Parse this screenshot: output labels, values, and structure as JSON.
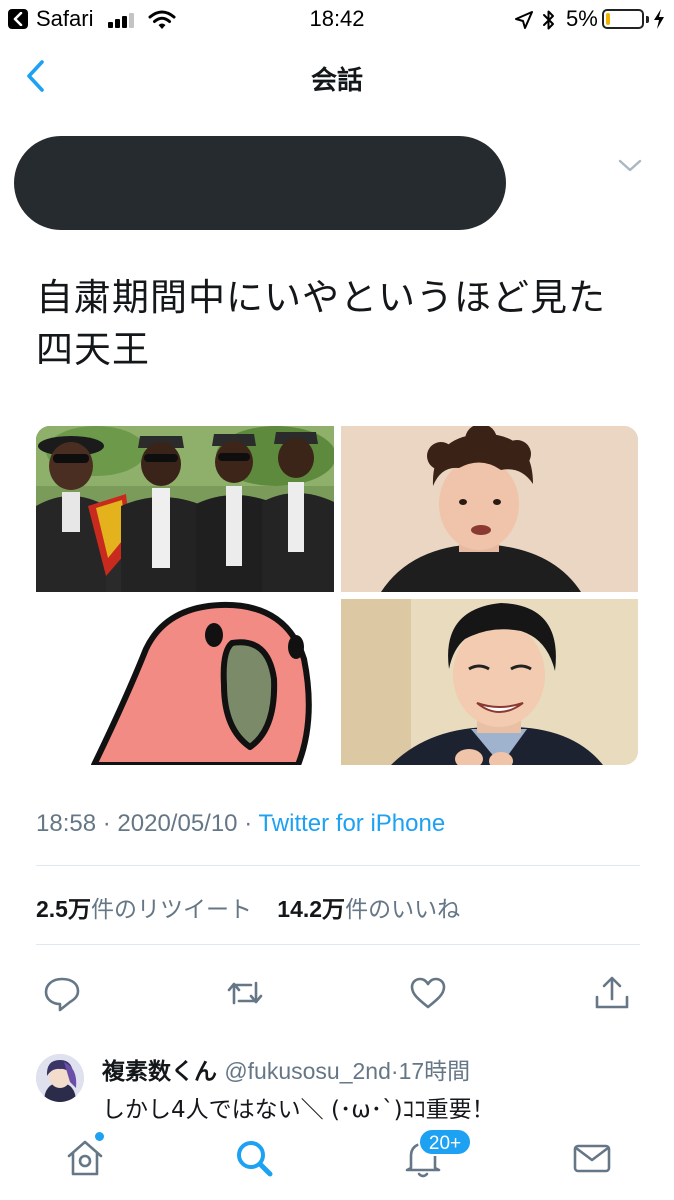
{
  "status_bar": {
    "carrier": "Safari",
    "time": "18:42",
    "battery_percent": "5%",
    "battery_level": 0.05,
    "icons": [
      "back-to-app-icon",
      "signal-icon",
      "wifi-icon",
      "location-arrow-icon",
      "bluetooth-icon",
      "battery-icon",
      "charging-bolt-icon"
    ]
  },
  "nav": {
    "title": "会話",
    "back_icon": "chevron-left-icon"
  },
  "tweet": {
    "text_line1": "自粛期間中にいやというほど見た",
    "text_line2": "四天王",
    "media": [
      {
        "name": "coffin-dance-pallbearers-photo"
      },
      {
        "name": "curly-hair-man-photo"
      },
      {
        "name": "pink-parrot-illustration"
      },
      {
        "name": "smiling-man-photo"
      }
    ],
    "time": "18:58",
    "date": "2020/05/10",
    "separator": "·",
    "source": "Twitter for iPhone",
    "retweets_count": "2.5万",
    "retweets_label": "件のリツイート",
    "likes_count": "14.2万",
    "likes_label": "件のいいね"
  },
  "actions": [
    "reply-icon",
    "retweet-icon",
    "like-icon",
    "share-icon"
  ],
  "reply": {
    "name": "複素数くん",
    "handle": "@fukusosu_2nd",
    "time": "17時間",
    "text": "しかし4人ではない＼ (･ω･`)ｺｺ重要！"
  },
  "tab_bar": {
    "tabs": [
      "home-icon",
      "search-icon",
      "notifications-icon",
      "messages-icon"
    ],
    "notification_badge": "20+"
  },
  "colors": {
    "accent": "#1da1f2",
    "text": "#14171a",
    "secondary": "#657786",
    "divider": "#e1e8ed"
  }
}
